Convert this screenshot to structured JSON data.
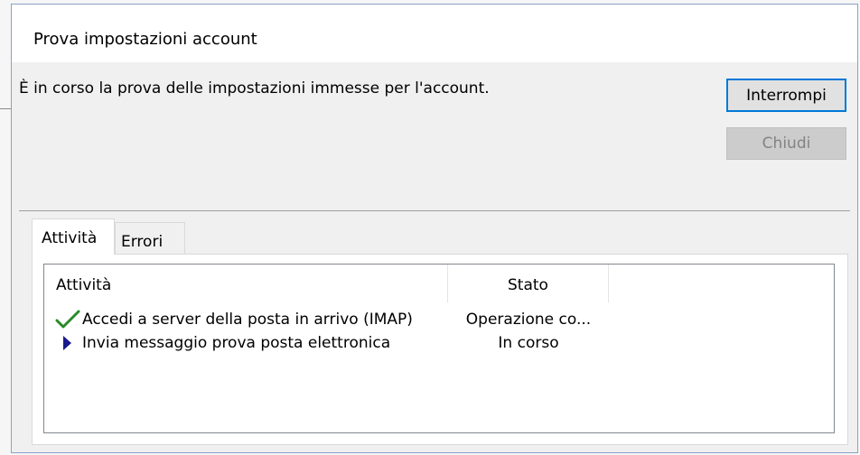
{
  "dialog": {
    "title": "Prova impostazioni account",
    "message": "È in corso la prova delle impostazioni immesse per l'account."
  },
  "buttons": {
    "stop_label": "Interrompi",
    "close_label": "Chiudi"
  },
  "tabs": [
    {
      "label": "Attività",
      "selected": true
    },
    {
      "label": "Errori",
      "selected": false
    }
  ],
  "table": {
    "columns": [
      "Attività",
      "Stato"
    ],
    "rows": [
      {
        "icon": "checkmark-icon",
        "activity": "Accedi a server della posta in arrivo (IMAP)",
        "status": "Operazione co..."
      },
      {
        "icon": "play-arrow-icon",
        "activity": "Invia messaggio prova posta elettronica",
        "status": "In corso"
      }
    ]
  },
  "colors": {
    "accent": "#0078d7",
    "check_green": "#2a8a2a",
    "arrow_navy": "#1a1a8c"
  }
}
